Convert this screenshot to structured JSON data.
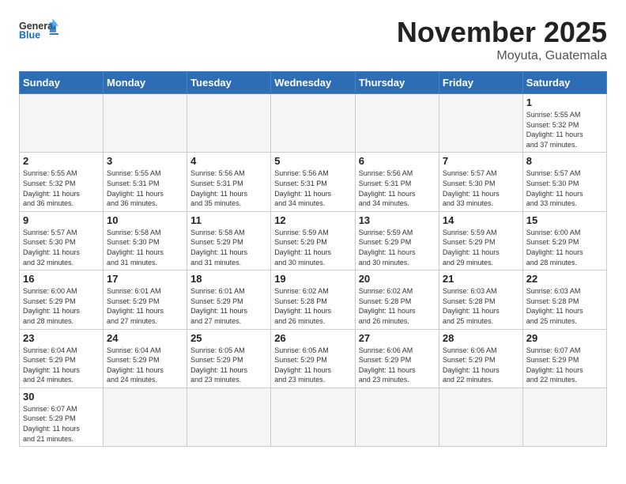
{
  "header": {
    "logo_general": "General",
    "logo_blue": "Blue",
    "month": "November 2025",
    "location": "Moyuta, Guatemala"
  },
  "weekdays": [
    "Sunday",
    "Monday",
    "Tuesday",
    "Wednesday",
    "Thursday",
    "Friday",
    "Saturday"
  ],
  "weeks": [
    [
      {
        "day": "",
        "info": ""
      },
      {
        "day": "",
        "info": ""
      },
      {
        "day": "",
        "info": ""
      },
      {
        "day": "",
        "info": ""
      },
      {
        "day": "",
        "info": ""
      },
      {
        "day": "",
        "info": ""
      },
      {
        "day": "1",
        "info": "Sunrise: 5:55 AM\nSunset: 5:32 PM\nDaylight: 11 hours\nand 37 minutes."
      }
    ],
    [
      {
        "day": "2",
        "info": "Sunrise: 5:55 AM\nSunset: 5:32 PM\nDaylight: 11 hours\nand 36 minutes."
      },
      {
        "day": "3",
        "info": "Sunrise: 5:55 AM\nSunset: 5:31 PM\nDaylight: 11 hours\nand 36 minutes."
      },
      {
        "day": "4",
        "info": "Sunrise: 5:56 AM\nSunset: 5:31 PM\nDaylight: 11 hours\nand 35 minutes."
      },
      {
        "day": "5",
        "info": "Sunrise: 5:56 AM\nSunset: 5:31 PM\nDaylight: 11 hours\nand 34 minutes."
      },
      {
        "day": "6",
        "info": "Sunrise: 5:56 AM\nSunset: 5:31 PM\nDaylight: 11 hours\nand 34 minutes."
      },
      {
        "day": "7",
        "info": "Sunrise: 5:57 AM\nSunset: 5:30 PM\nDaylight: 11 hours\nand 33 minutes."
      },
      {
        "day": "8",
        "info": "Sunrise: 5:57 AM\nSunset: 5:30 PM\nDaylight: 11 hours\nand 33 minutes."
      }
    ],
    [
      {
        "day": "9",
        "info": "Sunrise: 5:57 AM\nSunset: 5:30 PM\nDaylight: 11 hours\nand 32 minutes."
      },
      {
        "day": "10",
        "info": "Sunrise: 5:58 AM\nSunset: 5:30 PM\nDaylight: 11 hours\nand 31 minutes."
      },
      {
        "day": "11",
        "info": "Sunrise: 5:58 AM\nSunset: 5:29 PM\nDaylight: 11 hours\nand 31 minutes."
      },
      {
        "day": "12",
        "info": "Sunrise: 5:59 AM\nSunset: 5:29 PM\nDaylight: 11 hours\nand 30 minutes."
      },
      {
        "day": "13",
        "info": "Sunrise: 5:59 AM\nSunset: 5:29 PM\nDaylight: 11 hours\nand 30 minutes."
      },
      {
        "day": "14",
        "info": "Sunrise: 5:59 AM\nSunset: 5:29 PM\nDaylight: 11 hours\nand 29 minutes."
      },
      {
        "day": "15",
        "info": "Sunrise: 6:00 AM\nSunset: 5:29 PM\nDaylight: 11 hours\nand 28 minutes."
      }
    ],
    [
      {
        "day": "16",
        "info": "Sunrise: 6:00 AM\nSunset: 5:29 PM\nDaylight: 11 hours\nand 28 minutes."
      },
      {
        "day": "17",
        "info": "Sunrise: 6:01 AM\nSunset: 5:29 PM\nDaylight: 11 hours\nand 27 minutes."
      },
      {
        "day": "18",
        "info": "Sunrise: 6:01 AM\nSunset: 5:29 PM\nDaylight: 11 hours\nand 27 minutes."
      },
      {
        "day": "19",
        "info": "Sunrise: 6:02 AM\nSunset: 5:28 PM\nDaylight: 11 hours\nand 26 minutes."
      },
      {
        "day": "20",
        "info": "Sunrise: 6:02 AM\nSunset: 5:28 PM\nDaylight: 11 hours\nand 26 minutes."
      },
      {
        "day": "21",
        "info": "Sunrise: 6:03 AM\nSunset: 5:28 PM\nDaylight: 11 hours\nand 25 minutes."
      },
      {
        "day": "22",
        "info": "Sunrise: 6:03 AM\nSunset: 5:28 PM\nDaylight: 11 hours\nand 25 minutes."
      }
    ],
    [
      {
        "day": "23",
        "info": "Sunrise: 6:04 AM\nSunset: 5:29 PM\nDaylight: 11 hours\nand 24 minutes."
      },
      {
        "day": "24",
        "info": "Sunrise: 6:04 AM\nSunset: 5:29 PM\nDaylight: 11 hours\nand 24 minutes."
      },
      {
        "day": "25",
        "info": "Sunrise: 6:05 AM\nSunset: 5:29 PM\nDaylight: 11 hours\nand 23 minutes."
      },
      {
        "day": "26",
        "info": "Sunrise: 6:05 AM\nSunset: 5:29 PM\nDaylight: 11 hours\nand 23 minutes."
      },
      {
        "day": "27",
        "info": "Sunrise: 6:06 AM\nSunset: 5:29 PM\nDaylight: 11 hours\nand 23 minutes."
      },
      {
        "day": "28",
        "info": "Sunrise: 6:06 AM\nSunset: 5:29 PM\nDaylight: 11 hours\nand 22 minutes."
      },
      {
        "day": "29",
        "info": "Sunrise: 6:07 AM\nSunset: 5:29 PM\nDaylight: 11 hours\nand 22 minutes."
      }
    ],
    [
      {
        "day": "30",
        "info": "Sunrise: 6:07 AM\nSunset: 5:29 PM\nDaylight: 11 hours\nand 21 minutes."
      },
      {
        "day": "",
        "info": ""
      },
      {
        "day": "",
        "info": ""
      },
      {
        "day": "",
        "info": ""
      },
      {
        "day": "",
        "info": ""
      },
      {
        "day": "",
        "info": ""
      },
      {
        "day": "",
        "info": ""
      }
    ]
  ]
}
